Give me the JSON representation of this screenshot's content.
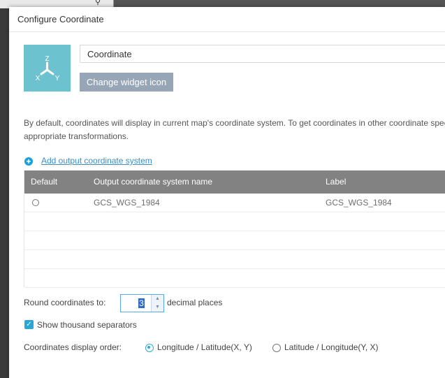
{
  "dialog": {
    "title": "Configure Coordinate"
  },
  "widget": {
    "name_value": "Coordinate",
    "change_icon_label": "Change widget icon",
    "icon_axis_labels": {
      "z": "Z",
      "x": "X",
      "y": "Y"
    }
  },
  "description": "By default, coordinates will display in current map's coordinate system. To get coordinates in other coordinate specify appropriate transformations.",
  "add_output_label": "Add output coordinate system",
  "table": {
    "headers": {
      "default": "Default",
      "name": "Output coordinate system name",
      "label": "Label"
    },
    "rows": [
      {
        "name": "GCS_WGS_1984",
        "label": "GCS_WGS_1984",
        "default_selected": false
      }
    ]
  },
  "round": {
    "label": "Round coordinates to:",
    "value": "3",
    "suffix": "decimal places"
  },
  "thousand_separators": {
    "label": "Show thousand separators",
    "checked": true
  },
  "display_order": {
    "label": "Coordinates display order:",
    "options": [
      {
        "label": "Longitude / Latitude(X, Y)",
        "selected": true
      },
      {
        "label": "Latitude / Longitude(Y, X)",
        "selected": false
      }
    ]
  },
  "colors": {
    "accent": "#2aa7d6",
    "header_bg": "#828282",
    "icon_bg": "#6cc2cf",
    "button_bg": "#97a6b6",
    "link": "#3a8dc4"
  },
  "icons": [
    "axis-icon",
    "add-circle-icon",
    "check-icon",
    "spin-up-icon",
    "spin-down-icon"
  ]
}
